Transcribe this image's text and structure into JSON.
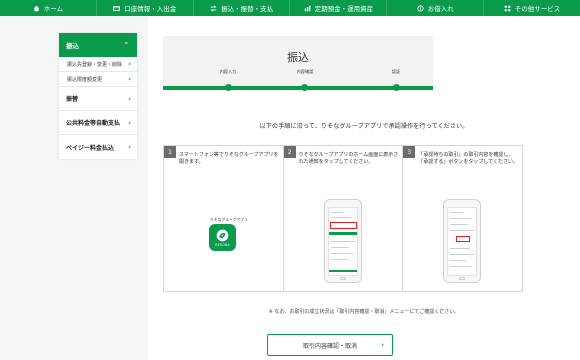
{
  "topnav": {
    "items": [
      {
        "label": "ホーム",
        "icon": "home-icon"
      },
      {
        "label": "口座情報・入出金",
        "icon": "account-icon"
      },
      {
        "label": "振込・振替・支払",
        "icon": "transfer-icon"
      },
      {
        "label": "定期預金・運用資産",
        "icon": "savings-icon"
      },
      {
        "label": "お借入れ",
        "icon": "loan-icon"
      },
      {
        "label": "その他サービス",
        "icon": "grid-icon"
      }
    ]
  },
  "sidebar": {
    "head": "振込",
    "sub_items": [
      "振込先登録・変更・削除",
      "振込限度額変更"
    ],
    "main_items": [
      "振替",
      "公共料金等自動支払",
      "ペイジー料金払込"
    ]
  },
  "page": {
    "title": "振込",
    "steps": [
      "内容入力",
      "内容確認",
      "認証"
    ],
    "instruction": "以下の手順に沿って、りそなグループアプリで承認操作を行ってください。"
  },
  "panels": [
    {
      "num": "1",
      "text": "スマートフォン等でりそなグループアプリを開きます。",
      "app_label": "りそなグループアプリ",
      "app_name": "RESONA"
    },
    {
      "num": "2",
      "text": "りそなグループアプリのホーム画面に表示された通知をタップしてください。"
    },
    {
      "num": "3",
      "text": "「承認待ちの取引」の取引内容を確認し、「承認する」ボタンをタップしてください。"
    }
  ],
  "note": "※ なお、お取引の成立状況は「取引内容確認・取消」メニューにてご確認ください。",
  "cta": {
    "label": "取引内容確認・取消"
  },
  "colors": {
    "brand": "#0a9a4c",
    "alert": "#e3211c"
  }
}
